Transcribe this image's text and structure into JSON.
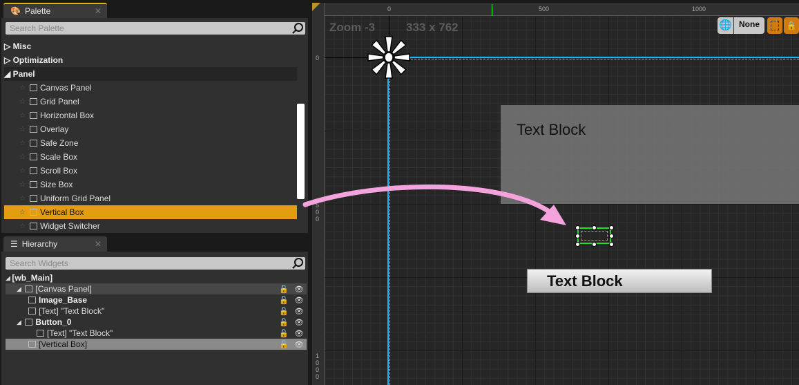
{
  "palette": {
    "title": "Palette",
    "search_placeholder": "Search Palette",
    "categories": [
      {
        "label": "Misc",
        "expanded": false
      },
      {
        "label": "Optimization",
        "expanded": false
      },
      {
        "label": "Panel",
        "expanded": true
      }
    ],
    "items": [
      "Canvas Panel",
      "Grid Panel",
      "Horizontal Box",
      "Overlay",
      "Safe Zone",
      "Scale Box",
      "Scroll Box",
      "Size Box",
      "Uniform Grid Panel",
      "Vertical Box",
      "Widget Switcher"
    ],
    "selected": "Vertical Box"
  },
  "hierarchy": {
    "title": "Hierarchy",
    "search_placeholder": "Search Widgets",
    "rows": [
      {
        "label": "[wb_Main]",
        "bold": true
      },
      {
        "label": "[Canvas Panel]"
      },
      {
        "label": "Image_Base",
        "bold": true
      },
      {
        "label": "[Text] \"Text Block\""
      },
      {
        "label": "Button_0",
        "bold": true
      },
      {
        "label": "[Text] \"Text Block\""
      },
      {
        "label": "[Vertical Box]"
      }
    ]
  },
  "designer": {
    "zoom": "Zoom -3",
    "size": "333 x 762",
    "ruler_top": [
      "0",
      "500",
      "1000"
    ],
    "ruler_left": [
      "0",
      "500",
      "1000"
    ],
    "dpi_dropdown": "None",
    "text_block_1": "Text Block",
    "button_text": "Text Block",
    "colors": {
      "accent": "#e39e0f",
      "guide": "#19b5fe",
      "selection": "#22e022",
      "arrow": "#f5a3dc"
    }
  }
}
